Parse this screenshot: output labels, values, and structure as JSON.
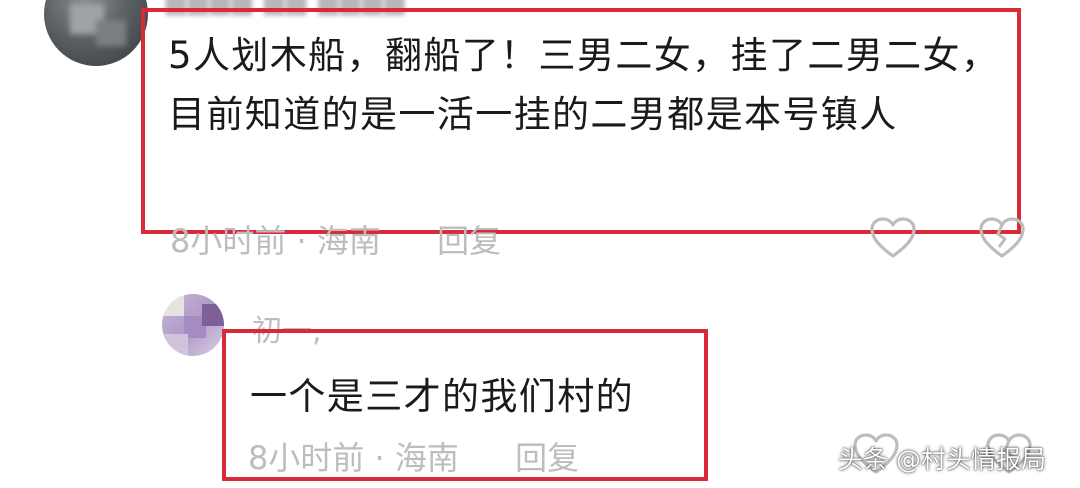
{
  "comments": [
    {
      "text": "5人划木船，翻船了！三男二女，挂了二男二女，目前知道的是一活一挂的二男都是本号镇人",
      "time": "8小时前",
      "separator": "·",
      "location": "海南",
      "reply_label": "回复"
    }
  ],
  "replies": [
    {
      "username": "初一,",
      "text": "一个是三才的我们村的",
      "time": "8小时前",
      "separator": "·",
      "location": "海南",
      "reply_label": "回复"
    }
  ],
  "watermark": "头条 @村头情报局",
  "colors": {
    "highlight_box": "#d92a3a",
    "meta_text": "#bdbdbd",
    "body_text": "#1a1a1a"
  },
  "icons": [
    "like-heart-icon",
    "dislike-broken-heart-icon"
  ]
}
